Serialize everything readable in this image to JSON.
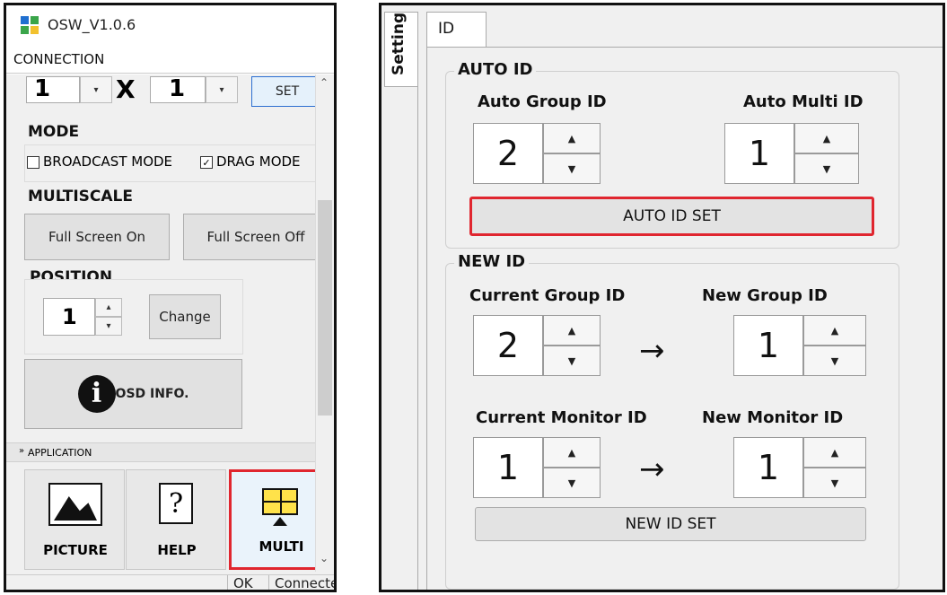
{
  "left_window": {
    "title": "OSW_V1.0.6",
    "menu": "CONNECTION",
    "grid": {
      "cols_value": "1",
      "times": "X",
      "rows_value": "1",
      "set_label": "SET"
    },
    "mode": {
      "heading": "MODE",
      "broadcast_label": "BROADCAST MODE",
      "broadcast_checked": false,
      "drag_label": "DRAG MODE",
      "drag_checked": true
    },
    "multiscale": {
      "heading": "MULTISCALE",
      "on_label": "Full Screen On",
      "off_label": "Full Screen Off"
    },
    "position": {
      "heading": "POSITION",
      "value": "1",
      "change_label": "Change"
    },
    "osd": {
      "label": "OSD INFO."
    },
    "application": {
      "label": "APPLICATION",
      "items": [
        {
          "label": "PICTURE"
        },
        {
          "label": "HELP"
        },
        {
          "label": "MULTI"
        }
      ]
    },
    "status": {
      "ok": "OK",
      "connected": "Connected"
    }
  },
  "right_window": {
    "side_tab": "Setting",
    "tab": "ID",
    "auto_id": {
      "heading": "AUTO ID",
      "group_label": "Auto Group ID",
      "group_value": "2",
      "multi_label": "Auto Multi ID",
      "multi_value": "1",
      "button": "AUTO ID SET"
    },
    "new_id": {
      "heading": "NEW ID",
      "current_group_label": "Current Group ID",
      "current_group_value": "2",
      "new_group_label": "New Group ID",
      "new_group_value": "1",
      "current_monitor_label": "Current Monitor ID",
      "current_monitor_value": "1",
      "new_monitor_label": "New Monitor ID",
      "new_monitor_value": "1",
      "arrow": "→",
      "button": "NEW ID SET"
    }
  },
  "colors": {
    "highlight": "#e0262f",
    "panel_bg": "#f0f0f0"
  }
}
